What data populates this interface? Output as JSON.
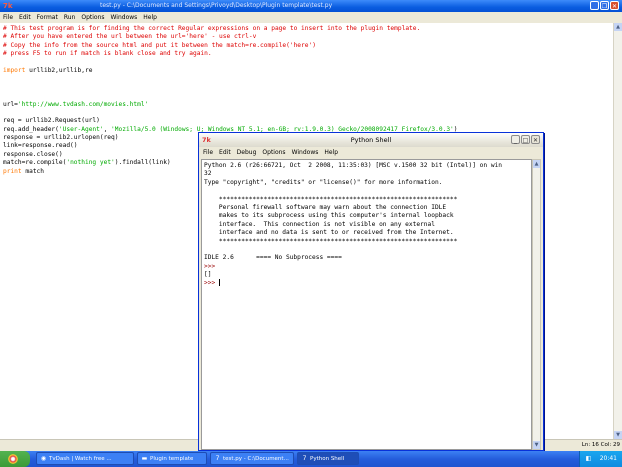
{
  "editor": {
    "title": "test.py - C:\\Documents and Settings\\Privoyd\\Desktop\\Plugin template\\test.py",
    "title_icon": "7k",
    "menu": [
      "File",
      "Edit",
      "Format",
      "Run",
      "Options",
      "Windows",
      "Help"
    ],
    "code_lines": [
      [
        {
          "t": "# This test program is for finding the correct Regular expressions on a page to insert into the plugin template.",
          "c": "comment"
        }
      ],
      [
        {
          "t": "# After you have entered the url between the url='here' - use ctrl-v",
          "c": "comment"
        }
      ],
      [
        {
          "t": "# Copy the info from the source html and put it between the match=re.compile('here')",
          "c": "comment"
        }
      ],
      [
        {
          "t": "# press F5 to run if match is blank close and try again.",
          "c": "comment"
        }
      ],
      [
        {
          "t": "",
          "c": ""
        }
      ],
      [
        {
          "t": "import",
          "c": "kw"
        },
        {
          "t": " urllib2,urllib,re",
          "c": ""
        }
      ],
      [
        {
          "t": "",
          "c": ""
        }
      ],
      [
        {
          "t": "",
          "c": ""
        }
      ],
      [
        {
          "t": "",
          "c": ""
        }
      ],
      [
        {
          "t": "url=",
          "c": ""
        },
        {
          "t": "'http://www.tvdash.com/movies.html'",
          "c": "str"
        }
      ],
      [
        {
          "t": "",
          "c": ""
        }
      ],
      [
        {
          "t": "req = urllib2.Request(url)",
          "c": ""
        }
      ],
      [
        {
          "t": "req.add_header(",
          "c": ""
        },
        {
          "t": "'User-Agent'",
          "c": "str"
        },
        {
          "t": ", ",
          "c": ""
        },
        {
          "t": "'Mozilla/5.0 (Windows; U; Windows NT 5.1; en-GB; rv:1.9.0.3) Gecko/2008092417 Firefox/3.0.3'",
          "c": "str"
        },
        {
          "t": ")",
          "c": ""
        }
      ],
      [
        {
          "t": "response = urllib2.urlopen(req)",
          "c": ""
        }
      ],
      [
        {
          "t": "link=response.read()",
          "c": ""
        }
      ],
      [
        {
          "t": "response.close()",
          "c": ""
        }
      ],
      [
        {
          "t": "match=re.compile(",
          "c": ""
        },
        {
          "t": "'nothing yet'",
          "c": "str"
        },
        {
          "t": ").findall(link)",
          "c": ""
        }
      ],
      [
        {
          "t": "print",
          "c": "kw"
        },
        {
          "t": " match",
          "c": ""
        }
      ]
    ],
    "status": "Ln: 16 Col: 29"
  },
  "shell": {
    "title": "Python Shell",
    "title_icon": "7k",
    "menu": [
      "File",
      "Edit",
      "Debug",
      "Options",
      "Windows",
      "Help"
    ],
    "lines": [
      [
        {
          "t": "Python 2.6 (r26:66721, Oct  2 2008, 11:35:03) [MSC v.1500 32 bit (Intel)] on win",
          "c": ""
        }
      ],
      [
        {
          "t": "32",
          "c": ""
        }
      ],
      [
        {
          "t": "Type \"copyright\", \"credits\" or \"license()\" for more information.",
          "c": ""
        }
      ],
      [
        {
          "t": "",
          "c": ""
        }
      ],
      [
        {
          "t": "    ****************************************************************",
          "c": ""
        }
      ],
      [
        {
          "t": "    Personal firewall software may warn about the connection IDLE",
          "c": ""
        }
      ],
      [
        {
          "t": "    makes to its subprocess using this computer's internal loopback",
          "c": ""
        }
      ],
      [
        {
          "t": "    interface.  This connection is not visible on any external",
          "c": ""
        }
      ],
      [
        {
          "t": "    interface and no data is sent to or received from the Internet.",
          "c": ""
        }
      ],
      [
        {
          "t": "    ****************************************************************",
          "c": ""
        }
      ],
      [
        {
          "t": "",
          "c": ""
        }
      ],
      [
        {
          "t": "IDLE 2.6      ==== No Subprocess ====",
          "c": ""
        }
      ],
      [
        {
          "t": ">>> ",
          "c": "prompt"
        }
      ],
      [
        {
          "t": "[]",
          "c": ""
        }
      ],
      [
        {
          "t": ">>> ",
          "c": "prompt"
        }
      ]
    ]
  },
  "taskbar": {
    "tasks": [
      {
        "label": "TvDash | Watch free ...",
        "icon": "firefox-icon",
        "glyph": "◉"
      },
      {
        "label": "Plugin template",
        "icon": "folder-icon",
        "glyph": "▬"
      },
      {
        "label": "test.py - C:\\Document...",
        "icon": "idle-icon",
        "glyph": "7"
      },
      {
        "label": "Python Shell",
        "icon": "idle-icon",
        "glyph": "7"
      }
    ],
    "time": "20:41"
  },
  "colors": {
    "comment": "#dd0000",
    "keyword": "#ff7700",
    "string": "#00aa00",
    "prompt": "#990000"
  }
}
